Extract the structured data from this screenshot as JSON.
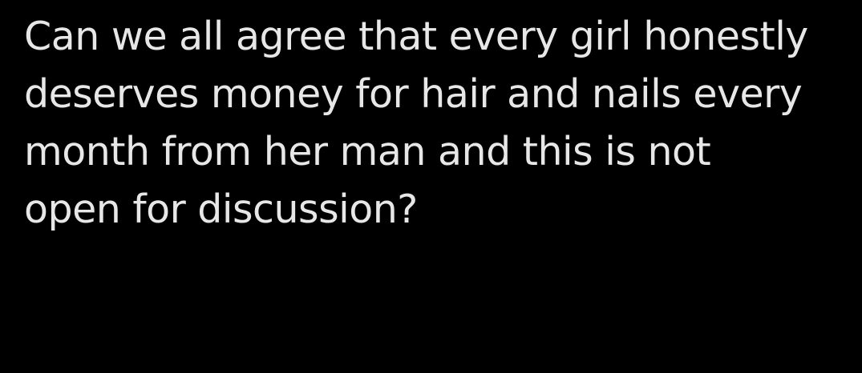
{
  "tweet": {
    "lines": [
      "Can we all agree that every girl honestly",
      "deserves money for hair and nails every",
      "month from her man and this is not",
      "open for discussion?"
    ]
  }
}
